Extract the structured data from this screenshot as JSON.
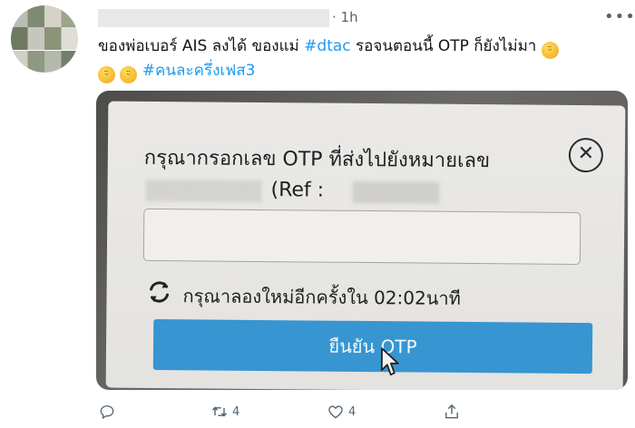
{
  "tweet": {
    "timestamp": "· 1h",
    "menu_icon": "more-dots-icon",
    "text_part1": "ของพ่อเบอร์ AIS ลงได้ ของแม่ ",
    "hashtag1": "#dtac",
    "text_part2": " รอจนตอนนี้ OTP ก็ยังไม่มา ",
    "hashtag2": "#คนละครึ่งเฟส3",
    "emoji": "steam-from-nose-face-emoji"
  },
  "otp_dialog": {
    "title": "กรุณากรอกเลข OTP ที่ส่งไปยังหมายเลข",
    "ref_label": "(Ref :",
    "countdown": "กรุณาลองใหม่อีกครั้งใน 02:02นาที",
    "confirm_label": "ยืนยัน OTP",
    "close_glyph": "✕"
  },
  "actions": {
    "reply_count": "",
    "retweet_count": "4",
    "like_count": "4",
    "share_count": ""
  },
  "colors": {
    "link": "#1d9bf0",
    "confirm_button": "#3795d1",
    "muted_text": "#536471"
  }
}
